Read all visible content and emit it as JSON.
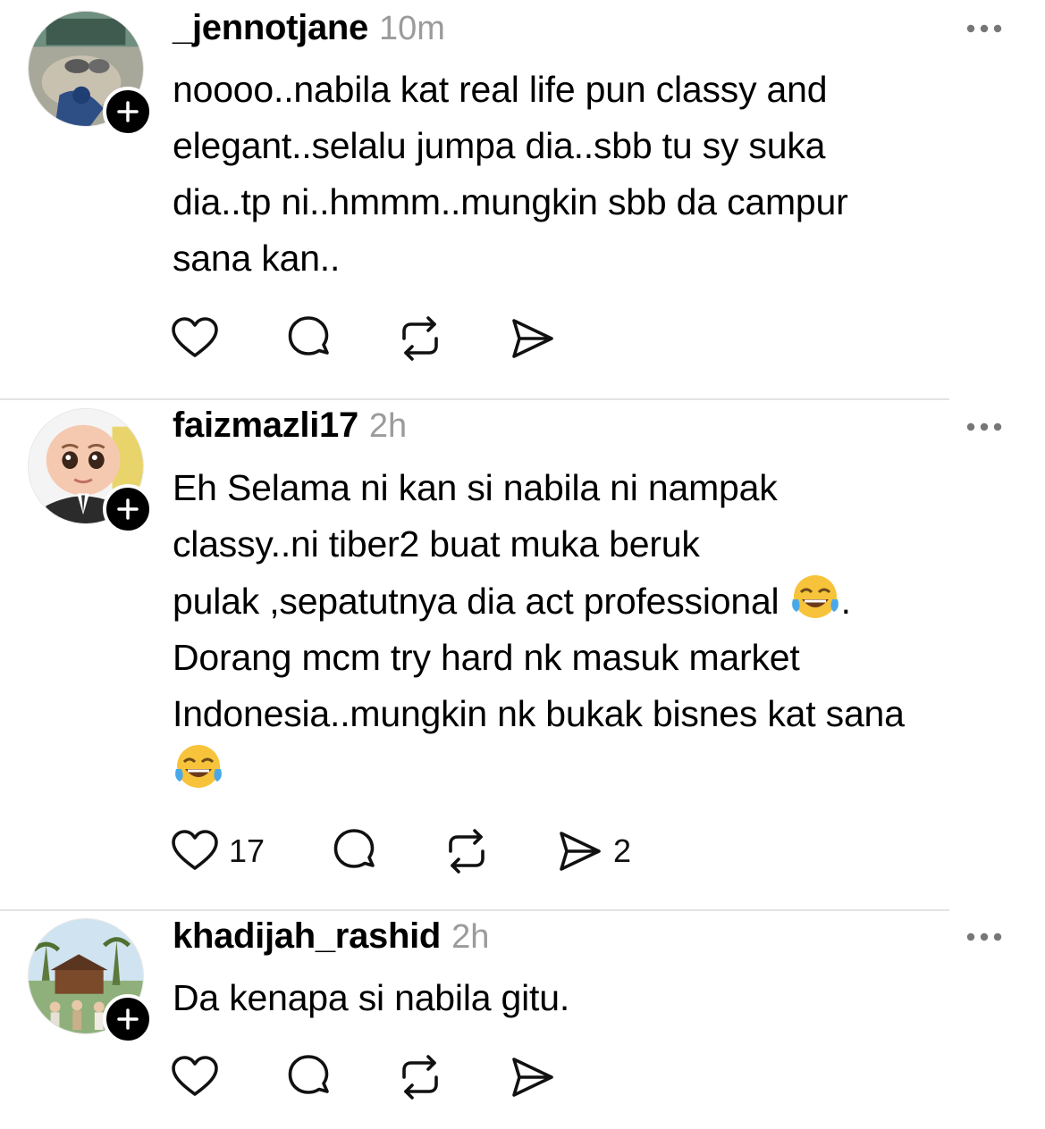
{
  "posts": [
    {
      "username": "_jennotjane",
      "time": "10m",
      "avatar_icon": "avatar-photo-icon",
      "text_lines": [
        "noooo..nabila kat real life pun classy and",
        "elegant..selalu jumpa dia..sbb tu sy suka",
        "dia..tp ni..hmmm..mungkin sbb da campur",
        "sana kan.."
      ],
      "like_count": "",
      "share_count": ""
    },
    {
      "username": "faizmazli17",
      "time": "2h",
      "avatar_icon": "avatar-baby-icon",
      "text_lines": [
        "Eh Selama ni kan si nabila ni nampak",
        "classy..ni tiber2 buat muka beruk",
        "pulak ,sepatutnya dia act professional",
        "Dorang mcm try hard nk masuk market",
        "Indonesia..mungkin nk bukak bisnes kat sana"
      ],
      "line3_suffix": ".",
      "emoji": "tears-of-joy-emoji",
      "like_count": "17",
      "share_count": "2"
    },
    {
      "username": "khadijah_rashid",
      "time": "2h",
      "avatar_icon": "avatar-group-photo-icon",
      "text_lines": [
        "Da kenapa si nabila gitu."
      ],
      "like_count": "",
      "share_count": ""
    }
  ],
  "icons": {
    "like": "heart-icon",
    "reply": "comment-bubble-icon",
    "repost": "repost-icon",
    "share": "send-icon",
    "more": "more-dots-icon",
    "follow": "plus-icon"
  },
  "colors": {
    "text": "#000000",
    "meta": "#9b9b9b",
    "divider": "#e3e3e3",
    "follow_bg": "#000000"
  }
}
